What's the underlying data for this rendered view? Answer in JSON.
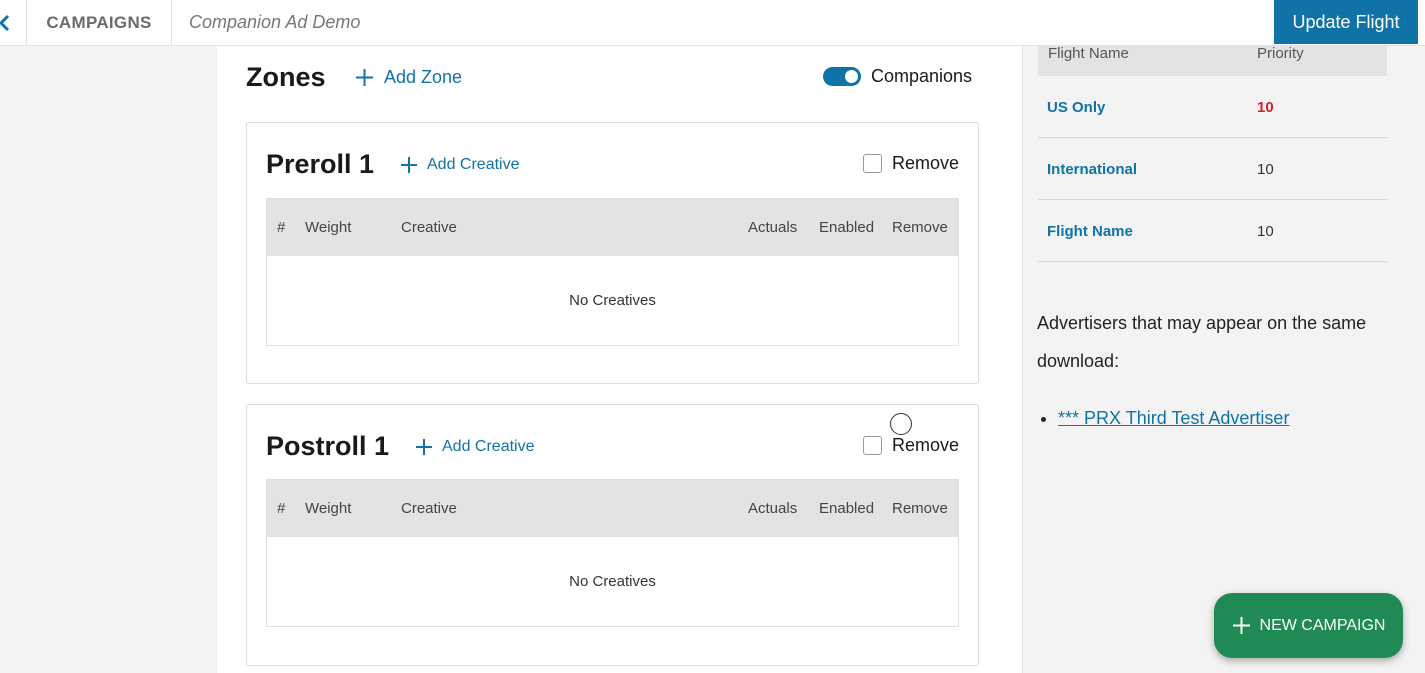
{
  "header": {
    "campaigns_label": "CAMPAIGNS",
    "campaign_title": "Companion Ad Demo",
    "update_button": "Update Flight"
  },
  "zones": {
    "heading": "Zones",
    "add_zone": "Add Zone",
    "companions_label": "Companions",
    "companions_on": true,
    "columns": [
      "#",
      "Weight",
      "Creative",
      "Actuals",
      "Enabled",
      "Remove"
    ],
    "items": [
      {
        "title": "Preroll 1",
        "add_creative": "Add Creative",
        "remove_label": "Remove",
        "empty_text": "No Creatives"
      },
      {
        "title": "Postroll 1",
        "add_creative": "Add Creative",
        "remove_label": "Remove",
        "empty_text": "No Creatives"
      }
    ]
  },
  "flights": {
    "columns": [
      "Flight Name",
      "Priority"
    ],
    "rows": [
      {
        "name": "US Only",
        "priority": "10",
        "highlight": true
      },
      {
        "name": "International",
        "priority": "10",
        "highlight": false
      },
      {
        "name": "Flight Name",
        "priority": "10",
        "highlight": false
      }
    ]
  },
  "advertisers": {
    "text": "Advertisers that may appear on the same download:",
    "items": [
      "*** PRX Third Test Advertiser"
    ]
  },
  "fab": {
    "label": "NEW CAMPAIGN"
  },
  "colors": {
    "accent": "#0f73a8",
    "fab": "#1f8a53",
    "priority_high": "#d0242f"
  }
}
